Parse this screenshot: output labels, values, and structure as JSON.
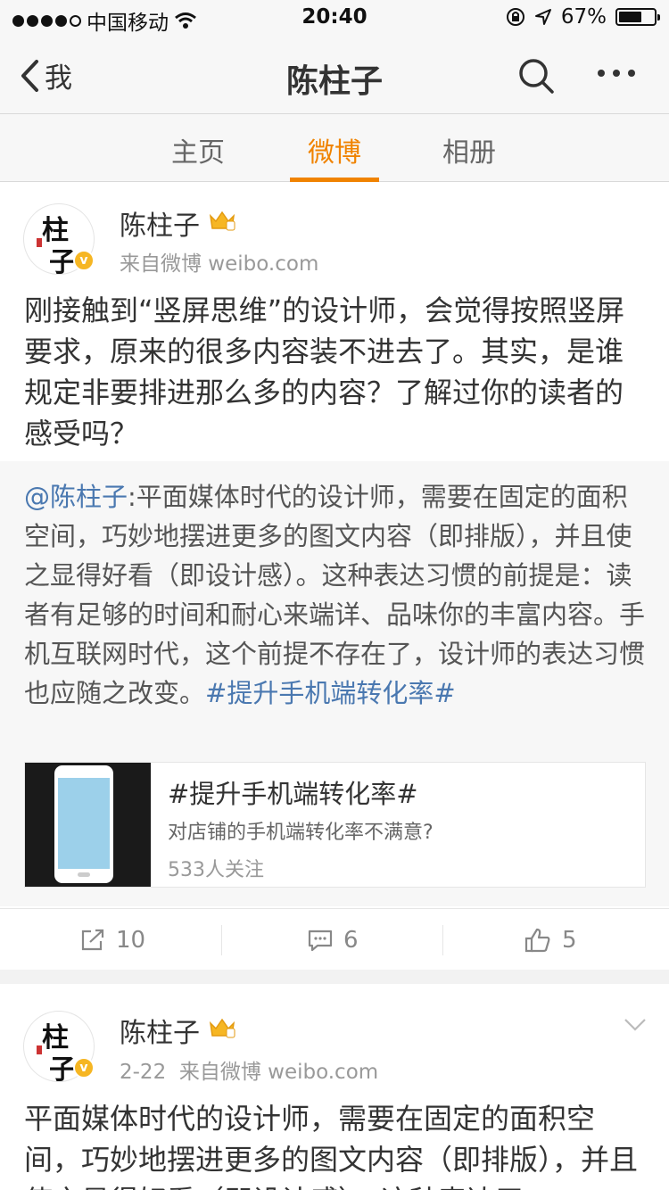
{
  "status_bar": {
    "carrier": "中国移动",
    "time": "20:40",
    "battery": "67%",
    "battery_level": 0.67
  },
  "nav": {
    "back_label": "我",
    "title": "陈柱子"
  },
  "tabs": [
    {
      "label": "主页",
      "active": false
    },
    {
      "label": "微博",
      "active": true
    },
    {
      "label": "相册",
      "active": false
    }
  ],
  "posts": [
    {
      "user": "陈柱子",
      "avatar_chars": [
        "柱",
        "子"
      ],
      "source": "来自微博 weibo.com",
      "text": "刚接触到“竖屏思维”的设计师，会觉得按照竖屏要求，原来的很多内容装不进去了。其实，是谁规定非要排进那么多的内容？了解过你的读者的感受吗？",
      "repost": {
        "mention": "@陈柱子",
        "text": ":平面媒体时代的设计师，需要在固定的面积空间，巧妙地摆进更多的图文内容（即排版），并且使之显得好看（即设计感）。这种表达习惯的前提是：读者有足够的时间和耐心来端详、品味你的丰富内容。手机互联网时代，这个前提不存在了，设计师的表达习惯也应随之改变。",
        "hashtag": "#提升手机端转化率#",
        "topic": {
          "title": "#提升手机端转化率#",
          "desc": "对店铺的手机端转化率不满意?",
          "followers": "533人关注"
        }
      },
      "actions": {
        "repost_count": "10",
        "comment_count": "6",
        "like_count": "5"
      }
    },
    {
      "user": "陈柱子",
      "avatar_chars": [
        "柱",
        "子"
      ],
      "source": "2-22  来自微博 weibo.com",
      "text": "平面媒体时代的设计师，需要在固定的面积空间，巧妙地摆进更多的图文内容（即排版），并且使之显得好看（即设计感）。这种表达习"
    }
  ],
  "colors": {
    "accent": "#f08300",
    "link": "#4a78b0",
    "badge": "#f6b623"
  }
}
